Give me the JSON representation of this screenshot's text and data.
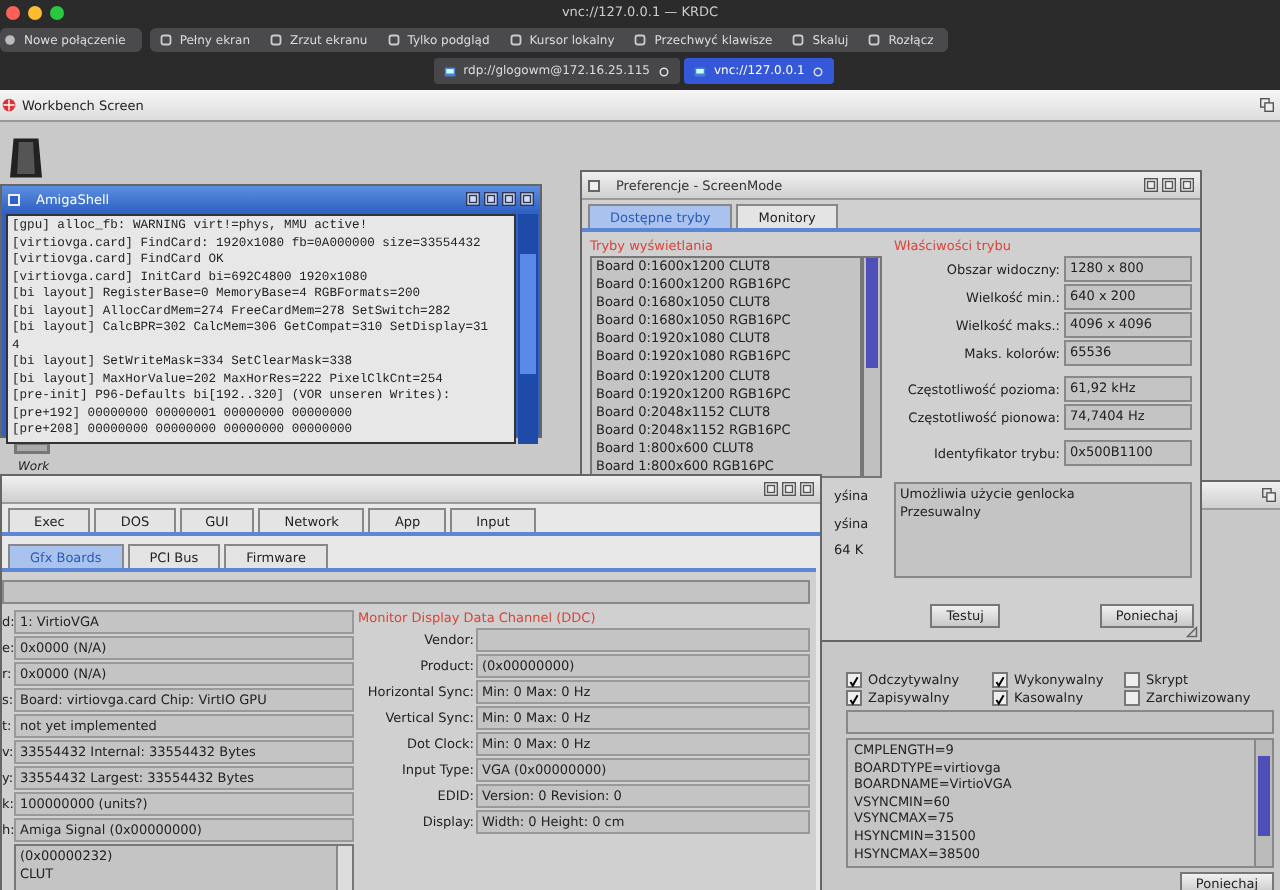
{
  "window": {
    "title": "vnc://127.0.0.1 — KRDC"
  },
  "connect_button": {
    "label": "Nowe połączenie"
  },
  "toolbar": [
    {
      "label": "Pełny ekran"
    },
    {
      "label": "Zrzut ekranu"
    },
    {
      "label": "Tylko podgląd"
    },
    {
      "label": "Kursor lokalny"
    },
    {
      "label": "Przechwyć klawisze"
    },
    {
      "label": "Skaluj"
    },
    {
      "label": "Rozłącz"
    }
  ],
  "connection_tabs": [
    {
      "label": "rdp://glogowm@172.16.25.115",
      "selected": false
    },
    {
      "label": "vnc://127.0.0.1",
      "selected": true
    }
  ],
  "screen": {
    "title": "Workbench Screen"
  },
  "desktop_icons": [
    {
      "label": "Work"
    }
  ],
  "shell": {
    "title": "AmigaShell",
    "lines": [
      "[gpu] alloc_fb: WARNING virt!=phys, MMU active!",
      "[virtiovga.card] FindCard: 1920x1080 fb=0A000000 size=33554432",
      "[virtiovga.card] FindCard OK",
      "[virtiovga.card] InitCard bi=692C4800 1920x1080",
      "[bi layout] RegisterBase=0 MemoryBase=4 RGBFormats=200",
      "[bi layout] AllocCardMem=274 FreeCardMem=278 SetSwitch=282",
      "[bi layout] CalcBPR=302 CalcMem=306 GetCompat=310 SetDisplay=31",
      "4",
      "[bi layout] SetWriteMask=334 SetClearMask=338",
      "[bi layout] MaxHorValue=202 MaxHorRes=222 PixelClkCnt=254",
      "[pre-init] P96-Defaults bi[192..320] (VOR unseren Writes):",
      "[pre+192] 00000000 00000001 00000000 00000000",
      "[pre+208] 00000000 00000000 00000000 00000000"
    ]
  },
  "screenmode": {
    "title": "Preferencje - ScreenMode",
    "tabs": [
      {
        "label": "Dostępne tryby",
        "selected": true
      },
      {
        "label": "Monitory",
        "selected": false
      }
    ],
    "modes_label": "Tryby wyświetlania",
    "modes": [
      "Board 0:1600x1200 CLUT8",
      "Board 0:1600x1200 RGB16PC",
      "Board 0:1680x1050 CLUT8",
      "Board 0:1680x1050 RGB16PC",
      "Board 0:1920x1080 CLUT8",
      "Board 0:1920x1080 RGB16PC",
      "Board 0:1920x1200 CLUT8",
      "Board 0:1920x1200 RGB16PC",
      "Board 0:2048x1152 CLUT8",
      "Board 0:2048x1152 RGB16PC",
      "Board 1:800x600 CLUT8",
      "Board 1:800x600 RGB16PC"
    ],
    "props_label": "Właściwości trybu",
    "prop_sections": [
      {
        "props": [
          {
            "label": "Obszar widoczny:",
            "value": "1280 x 800"
          },
          {
            "label": "Wielkość min.:",
            "value": "640 x 200"
          },
          {
            "label": "Wielkość maks.:",
            "value": "4096 x 4096"
          },
          {
            "label": "Maks. kolorów:",
            "value": "65536"
          }
        ]
      },
      {
        "props": [
          {
            "label": "Częstotliwość pozioma:",
            "value": "61,92 kHz"
          },
          {
            "label": "Częstotliwość pionowa:",
            "value": "74,7404 Hz"
          }
        ]
      },
      {
        "props": [
          {
            "label": "Identyfikator trybu:",
            "value": "0x500B1100"
          }
        ]
      }
    ],
    "flags": [
      "Umożliwia użycie genlocka",
      "Przesuwalny"
    ],
    "partial_texts": [
      "yśina",
      "yśina",
      "64 K"
    ],
    "buttons": [
      "Testuj",
      "Poniechaj"
    ]
  },
  "sysinfo": {
    "tabs": [
      {
        "label": "Exec",
        "selected": false
      },
      {
        "label": "DOS",
        "selected": false
      },
      {
        "label": "GUI",
        "selected": false
      },
      {
        "label": "Network",
        "selected": false
      },
      {
        "label": "App",
        "selected": false
      },
      {
        "label": "Input",
        "selected": false
      }
    ],
    "subtabs": [
      {
        "label": "Gfx Boards",
        "selected": true
      },
      {
        "label": "PCI Bus",
        "selected": false
      },
      {
        "label": "Firmware",
        "selected": false
      }
    ],
    "fields": [
      {
        "label": "d:",
        "value": "1: VirtioVGA"
      },
      {
        "label": "e:",
        "value": "0x0000 (N/A)"
      },
      {
        "label": "r:",
        "value": "0x0000 (N/A)"
      },
      {
        "label": "s:",
        "value": "Board: virtiovga.card Chip: VirtIO GPU"
      },
      {
        "label": "t:",
        "value": "not yet implemented"
      },
      {
        "label": "v:",
        "value": "33554432 Internal: 33554432 Bytes"
      },
      {
        "label": "y:",
        "value": "33554432 Largest: 33554432 Bytes"
      },
      {
        "label": "k:",
        "value": "100000000 (units?)"
      },
      {
        "label": "h:",
        "value": "Amiga Signal (0x00000000)"
      }
    ],
    "list": [
      "(0x00000232)",
      "CLUT"
    ],
    "ddc_label": "Monitor Display Data Channel (DDC)",
    "ddc": [
      {
        "label": "Vendor:"
      },
      {
        "label": "Product:",
        "value": "(0x00000000)"
      },
      {
        "label": "Horizontal Sync:",
        "value": "Min: 0 Max: 0 Hz"
      },
      {
        "label": "Vertical Sync:",
        "value": "Min: 0 Max: 0 Hz"
      },
      {
        "label": "Dot Clock:",
        "value": "Min: 0 Max: 0 Hz"
      },
      {
        "label": "Input Type:",
        "value": "VGA (0x00000000)"
      },
      {
        "label": "EDID:",
        "value": "Version: 0 Revision: 0"
      },
      {
        "label": "Display:",
        "value": "Width: 0 Height: 0 cm"
      }
    ]
  },
  "file_window": {
    "checkboxes": [
      {
        "label": "Odczytywalny",
        "checked": true
      },
      {
        "label": "Wykonywalny",
        "checked": true
      },
      {
        "label": "Skrypt",
        "checked": false
      },
      {
        "label": "Zapisywalny",
        "checked": true
      },
      {
        "label": "Kasowalny",
        "checked": true
      },
      {
        "label": "Zarchiwizowany",
        "checked": false
      }
    ],
    "lines": [
      "CMPLENGTH=9",
      "BOARDTYPE=virtiovga",
      "BOARDNAME=VirtioVGA",
      "VSYNCMIN=60",
      "VSYNCMAX=75",
      "HSYNCMIN=31500",
      "HSYNCMAX=38500"
    ],
    "button": "Poniechaj"
  }
}
